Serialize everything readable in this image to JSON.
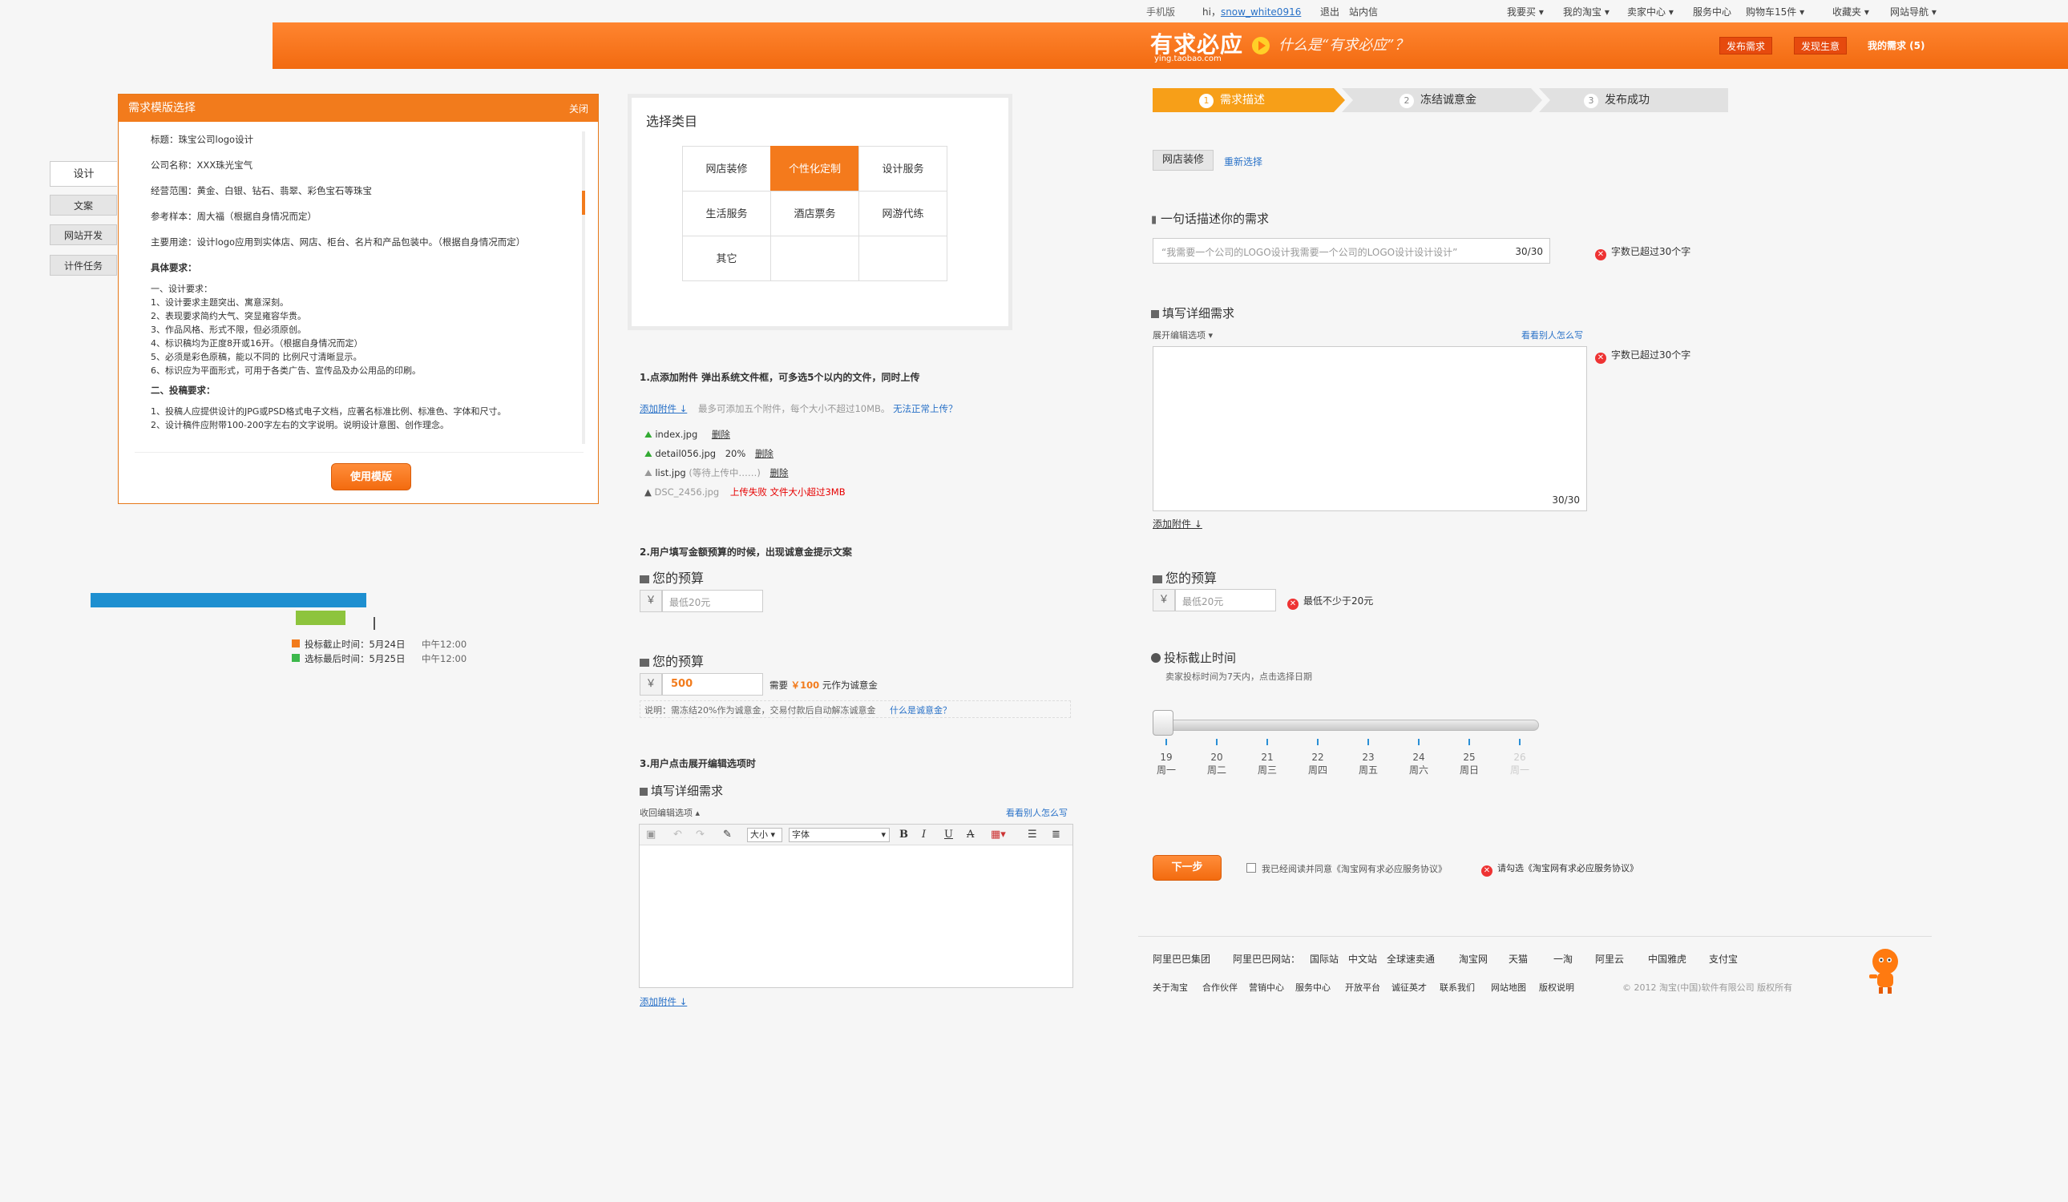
{
  "topbar": {
    "phone": "手机版",
    "hi": "hi，",
    "user": "snow_white0916",
    "logout": "退出",
    "msg": "站内信",
    "buy": "我要买 ▾",
    "mytaobao": "我的淘宝 ▾",
    "seller": "卖家中心 ▾",
    "service": "服务中心",
    "cart": "购物车15件 ▾",
    "fav": "收藏夹 ▾",
    "sitenav": "网站导航 ▾"
  },
  "header": {
    "logo": "有求必应",
    "logo_sub": "ying.taobao.com",
    "slogan": "什么是“有求必应”？",
    "btn_post": "发布需求",
    "btn_biz": "发现生意",
    "my": "我的需求 (5)"
  },
  "template": {
    "title": "需求模版选择",
    "close": "关闭",
    "use_btn": "使用模版",
    "lines": [
      "标题：珠宝公司logo设计",
      "公司名称：XXX珠光宝气",
      "经营范围：黄金、白银、钻石、翡翠、彩色宝石等珠宝",
      "参考样本：周大福（根据自身情况而定）",
      "主要用途：设计logo应用到实体店、网店、柜台、名片和产品包装中。（根据自身情况而定）",
      "具体要求：",
      "一、设计要求：\n1、设计要求主题突出、寓意深刻。\n2、表现要求简约大气、突显雍容华贵。\n3、作品风格、形式不限，但必须原创。\n4、标识稿均为正度8开或16开。（根据自身情况而定）\n5、必须是彩色原稿，能以不同的 比例尺寸清晰显示。\n6、标识应为平面形式，可用于各类广告、宣传品及办公用品的印刷。",
      "二、投稿要求：",
      "1、投稿人应提供设计的JPG或PSD格式电子文档，应著名标准比例、标准色、字体和尺寸。\n2、设计稿件应附带100-200字左右的文字说明。说明设计意图、创作理念。"
    ]
  },
  "left_tabs": [
    "设计",
    "文案",
    "网站开发",
    "计件任务"
  ],
  "timeline": {
    "deadline_label": "投标截止时间：5月24日",
    "deadline_time": "中午12:00",
    "select_label": "选标最后时间：5月25日",
    "select_time": "中午12:00",
    "deadline_color": "#f27b1c",
    "select_color": "#3cb84b",
    "bar_color": "#1e8fd0",
    "green_bar": "#8dc43d"
  },
  "category": {
    "title": "选择类目",
    "cells": [
      "网店装修",
      "个性化定制",
      "设计服务",
      "生活服务",
      "酒店票务",
      "网游代练",
      "其它",
      "",
      ""
    ],
    "selected": "个性化定制"
  },
  "attach": {
    "step1": "1.点添加附件 弹出系统文件框，可多选5个以内的文件，同时上传",
    "add": "添加附件",
    "hint": "最多可添加五个附件，每个大小不超过10MB。",
    "cant": "无法正常上传？",
    "files": [
      {
        "name": "index.jpg",
        "pct": "",
        "del": "删除",
        "status": ""
      },
      {
        "name": "detail056.jpg",
        "pct": "20%",
        "del": "删除",
        "status": ""
      },
      {
        "name": "list.jpg",
        "pct": "(等待上传中……)",
        "del": "删除",
        "status": ""
      },
      {
        "name": "DSC_2456.jpg",
        "pct": "",
        "del": "",
        "status": "上传失败 文件大小超过3MB"
      }
    ]
  },
  "budget": {
    "step2": "2.用户填写金额预算的时候，出现诚意金提示文案",
    "title": "您的预算",
    "yen": "￥",
    "placeholder": "最低20元",
    "value": "500",
    "need": "需要",
    "deposit": "￥100",
    "as_deposit": "元作为诚意金",
    "note": "说明：需冻结20%作为诚意金，交易付款后自动解冻诚意金",
    "what": "什么是诚意金？"
  },
  "editor": {
    "step3": "3.用户点击展开编辑选项时",
    "title": "填写详细需求",
    "collapse": "收回编辑选项",
    "others": "看看别人怎么写",
    "size": "大小",
    "font": "字体",
    "add": "添加附件"
  },
  "steps": [
    "需求描述",
    "冻结诚意金",
    "发布成功"
  ],
  "right": {
    "cat_tag": "网店装修",
    "reselect": "重新选择",
    "one_line": "一句话描述你的需求",
    "one_line_text": "“我需要一个公司的LOGO设计我需要一个公司的LOGO设计设计设计”",
    "counter": "30/30",
    "err_30": "字数已超过30个字",
    "detail": "填写详细需求",
    "expand": "展开编辑选项",
    "others": "看看别人怎么写",
    "detail_counter": "30/30",
    "add": "添加附件",
    "budget": "您的预算",
    "budget_ph": "最低20元",
    "err_budget": "最低不少于20元",
    "deadline": "投标截止时间",
    "deadline_hint": "卖家投标时间为7天内，点击选择日期",
    "days": [
      {
        "d": "19",
        "w": "周一"
      },
      {
        "d": "20",
        "w": "周二"
      },
      {
        "d": "21",
        "w": "周三"
      },
      {
        "d": "22",
        "w": "周四"
      },
      {
        "d": "23",
        "w": "周五"
      },
      {
        "d": "24",
        "w": "周六"
      },
      {
        "d": "25",
        "w": "周日"
      },
      {
        "d": "26",
        "w": "周一"
      }
    ],
    "next": "下一步",
    "agree": "我已经阅读并同意《淘宝网有求必应服务协议》",
    "err_agree": "请勾选《淘宝网有求必应服务协议》"
  },
  "footer": {
    "row1": [
      "阿里巴巴集团",
      "阿里巴巴网站：",
      "国际站",
      "中文站",
      "全球速卖通",
      "淘宝网",
      "天猫",
      "一淘",
      "阿里云",
      "中国雅虎",
      "支付宝"
    ],
    "row2": [
      "关于淘宝",
      "合作伙伴",
      "营销中心",
      "服务中心",
      "开放平台",
      "诚征英才",
      "联系我们",
      "网站地图",
      "版权说明"
    ],
    "copy": "© 2012 淘宝(中国)软件有限公司 版权所有"
  }
}
